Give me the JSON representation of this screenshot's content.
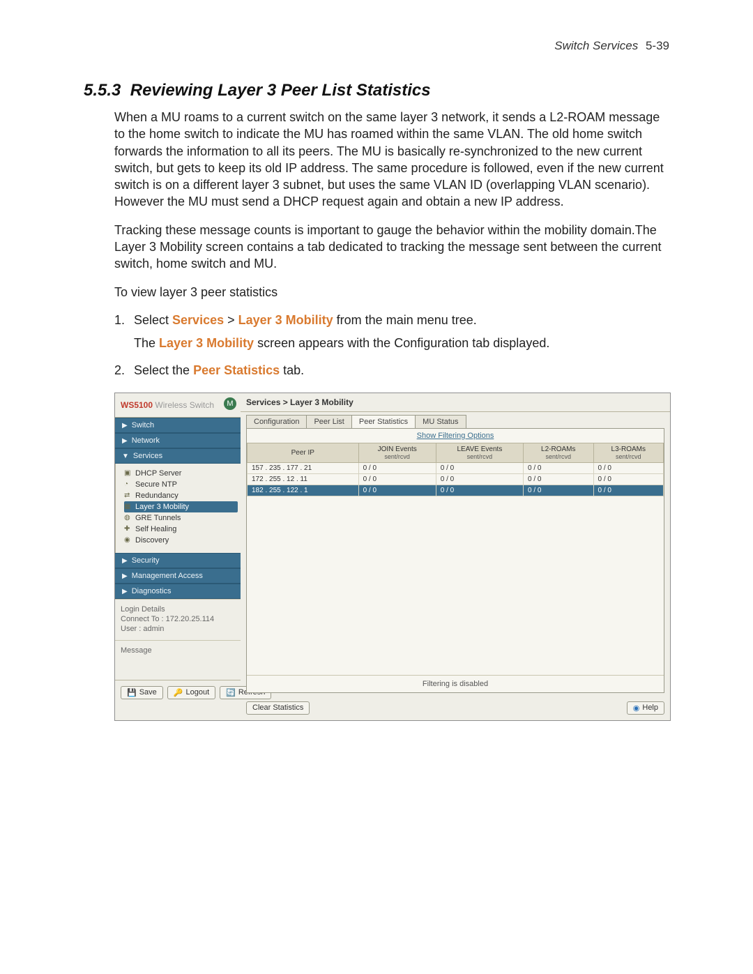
{
  "header": {
    "running": "Switch Services",
    "page": "5-39"
  },
  "section": {
    "number": "5.5.3",
    "title": "Reviewing Layer 3 Peer List Statistics"
  },
  "paras": {
    "p1": "When a MU roams to a current switch on the same layer 3 network, it sends a L2-ROAM message to the home switch to indicate the MU has roamed within the same VLAN. The old home switch forwards the information to all its peers. The MU is basically re-synchronized to the new current switch, but gets to keep its old IP address. The same procedure is followed, even if the new current switch is on a different layer 3 subnet, but uses the same VLAN ID (overlapping VLAN scenario). However the MU must send a DHCP request again and obtain a new IP address.",
    "p2": "Tracking these message counts is important to gauge the behavior within the mobility domain.The Layer 3 Mobility screen contains a tab dedicated to tracking the message sent between the current switch, home switch and MU.",
    "lead": "To view layer 3 peer statistics"
  },
  "steps": {
    "s1a": "Select ",
    "s1b": "Services",
    "s1c": " > ",
    "s1d": "Layer 3 Mobility",
    "s1e": " from the main menu tree.",
    "s1sub_a": "The ",
    "s1sub_b": "Layer 3 Mobility",
    "s1sub_c": " screen appears with the Configuration tab displayed.",
    "s2a": "Select the ",
    "s2b": "Peer Statistics",
    "s2c": " tab."
  },
  "ui": {
    "brand1": "WS5100",
    "brand2": " Wireless Switch",
    "moto": "M",
    "nav": {
      "switch": "Switch",
      "network": "Network",
      "services": "Services",
      "security": "Security",
      "mgmt": "Management Access",
      "diag": "Diagnostics"
    },
    "tree": [
      "DHCP Server",
      "Secure NTP",
      "Redundancy",
      "Layer 3 Mobility",
      "GRE Tunnels",
      "Self Healing",
      "Discovery"
    ],
    "login": {
      "title": "Login Details",
      "connect_label": "Connect To :",
      "connect_value": "172.20.25.114",
      "user_label": "User :",
      "user_value": "admin"
    },
    "message_title": "Message",
    "buttons": {
      "save": "Save",
      "logout": "Logout",
      "refresh": "Refresh",
      "clear": "Clear Statistics",
      "help": "Help"
    },
    "crumb": "Services > Layer 3 Mobility",
    "tabs": [
      "Configuration",
      "Peer List",
      "Peer Statistics",
      "MU Status"
    ],
    "active_tab": 2,
    "filter_link": "Show Filtering Options",
    "columns": [
      {
        "t": "Peer IP",
        "s": ""
      },
      {
        "t": "JOIN Events",
        "s": "sent/rcvd"
      },
      {
        "t": "LEAVE Events",
        "s": "sent/rcvd"
      },
      {
        "t": "L2-ROAMs",
        "s": "sent/rcvd"
      },
      {
        "t": "L3-ROAMs",
        "s": "sent/rcvd"
      }
    ],
    "rows": [
      {
        "ip": "157 . 235 . 177 . 21",
        "join": "0 / 0",
        "leave": "0 / 0",
        "l2": "0 / 0",
        "l3": "0 / 0"
      },
      {
        "ip": "172 . 255 . 12 . 11",
        "join": "0 / 0",
        "leave": "0 / 0",
        "l2": "0 / 0",
        "l3": "0 / 0"
      },
      {
        "ip": "182 . 255 . 122 . 1",
        "join": "0 / 0",
        "leave": "0 / 0",
        "l2": "0 / 0",
        "l3": "0 / 0"
      }
    ],
    "filter_status": "Filtering is disabled"
  }
}
